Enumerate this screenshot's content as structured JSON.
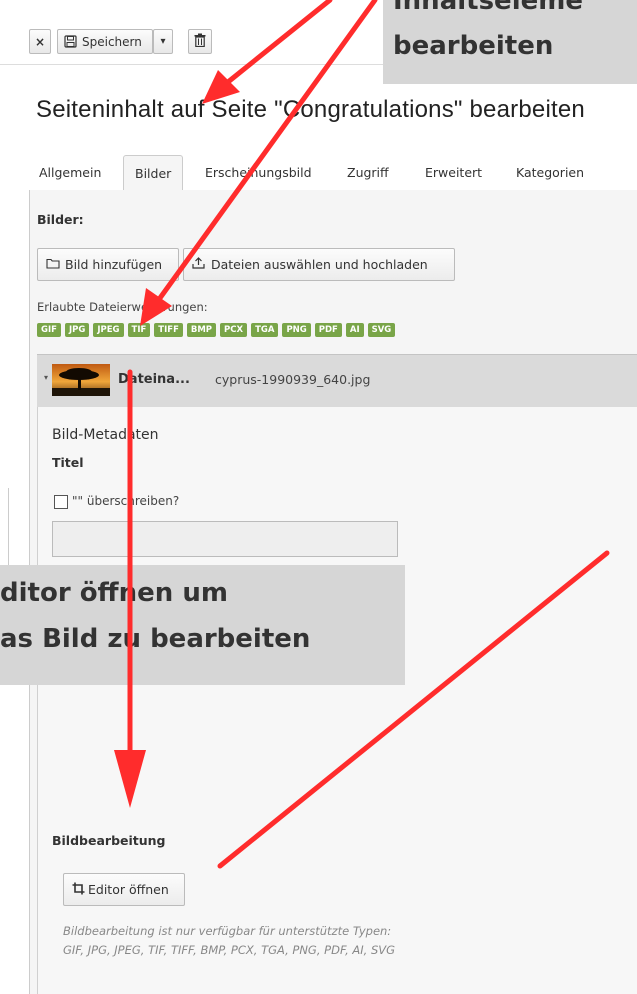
{
  "toolbar": {
    "close_label": "×",
    "save_label": "Speichern",
    "dropdown_label": "▾",
    "delete_icon": "trash-icon"
  },
  "page_title": "Seiteninhalt auf Seite \"Congratulations\" bearbeiten",
  "tabs": [
    {
      "label": "Allgemein"
    },
    {
      "label": "Bilder",
      "active": true
    },
    {
      "label": "Erscheinungsbild"
    },
    {
      "label": "Zugriff"
    },
    {
      "label": "Erweitert"
    },
    {
      "label": "Kategorien"
    }
  ],
  "images_section": {
    "heading": "Bilder:",
    "add_image_button": "Bild hinzufügen",
    "upload_button": "Dateien auswählen und hochladen",
    "allowed_label": "Erlaubte Dateierweiterungen:",
    "extensions": [
      "GIF",
      "JPG",
      "JPEG",
      "TIF",
      "TIFF",
      "BMP",
      "PCX",
      "TGA",
      "PNG",
      "PDF",
      "AI",
      "SVG"
    ]
  },
  "file_item": {
    "label": "Dateina...",
    "filename": "cyprus-1990939_640.jpg",
    "metadata_heading": "Bild-Metadaten",
    "title_label": "Titel",
    "override_label": "\"\" überschreiben?",
    "title_value": ""
  },
  "image_editing": {
    "heading": "Bildbearbeitung",
    "editor_button": "Editor öffnen",
    "hint_line1": "Bildbearbeitung ist nur verfügbar für unterstützte Typen:",
    "hint_line2": "GIF, JPG, JPEG, TIF, TIFF, BMP, PCX, TGA, PNG, PDF, AI, SVG"
  },
  "callouts": {
    "top_line1": "Inhaltseleme",
    "top_line2": "bearbeiten",
    "middle_line1": "ditor öffnen um",
    "middle_line2": "as Bild zu bearbeiten"
  },
  "colors": {
    "arrow": "#ff2c2c",
    "extension_badge": "#79a548",
    "callout_bg": "#d6d6d6"
  }
}
